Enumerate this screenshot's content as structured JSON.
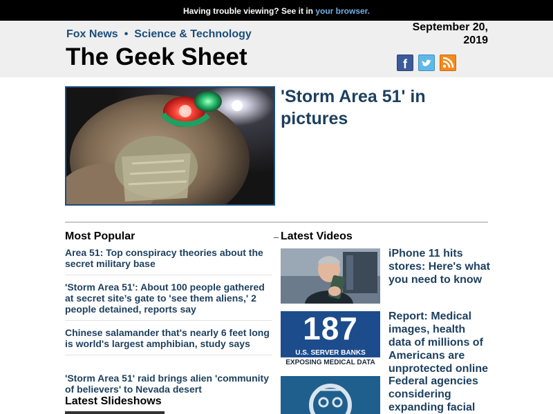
{
  "topbar": {
    "text": "Having trouble viewing? See it in ",
    "link": "your browser."
  },
  "header": {
    "nav": [
      "Fox News",
      "Science & Technology"
    ],
    "title": "The Geek Sheet",
    "date_line1": "September 20,",
    "date_line2": "2019",
    "social": [
      {
        "name": "facebook-icon",
        "glyph": "f",
        "color": "#3b5a9a"
      },
      {
        "name": "twitter-icon",
        "glyph": "t",
        "color": "#5fb8e8"
      },
      {
        "name": "rss-icon",
        "glyph": "rss",
        "color": "#f38a1e"
      }
    ]
  },
  "hero": {
    "title": "'Storm Area 51' in pictures"
  },
  "most_popular": {
    "heading": "Most Popular",
    "items": [
      "Area 51: Top conspiracy theories about the secret military base",
      "'Storm Area 51': About 100 people gathered at secret site’s gate to 'see them aliens,' 2 people detained, reports say",
      "Chinese salamander that's nearly 6 feet long is world's largest amphibian, study says",
      "'Storm Area 51' raid brings alien 'community of believers' to Nevada desert"
    ]
  },
  "latest_videos": {
    "heading": "Latest Videos",
    "items": [
      {
        "title": "iPhone 11 hits stores: Here's what you need to know"
      },
      {
        "title": "Report: Medical images, health data of millions of Americans are unprotected online",
        "thumb_number": "187",
        "thumb_caption_1": "U.S. SERVER BANKS",
        "thumb_caption_2": "EXPOSING MEDICAL DATA"
      },
      {
        "title": "Federal agencies considering expanding facial"
      }
    ]
  },
  "latest_slideshows": {
    "heading": "Latest Slideshows"
  },
  "colors": {
    "link": "#1c3f5e",
    "nav": "#1c4d7a",
    "header_bg": "#efefef",
    "topbar_bg": "#000000"
  }
}
